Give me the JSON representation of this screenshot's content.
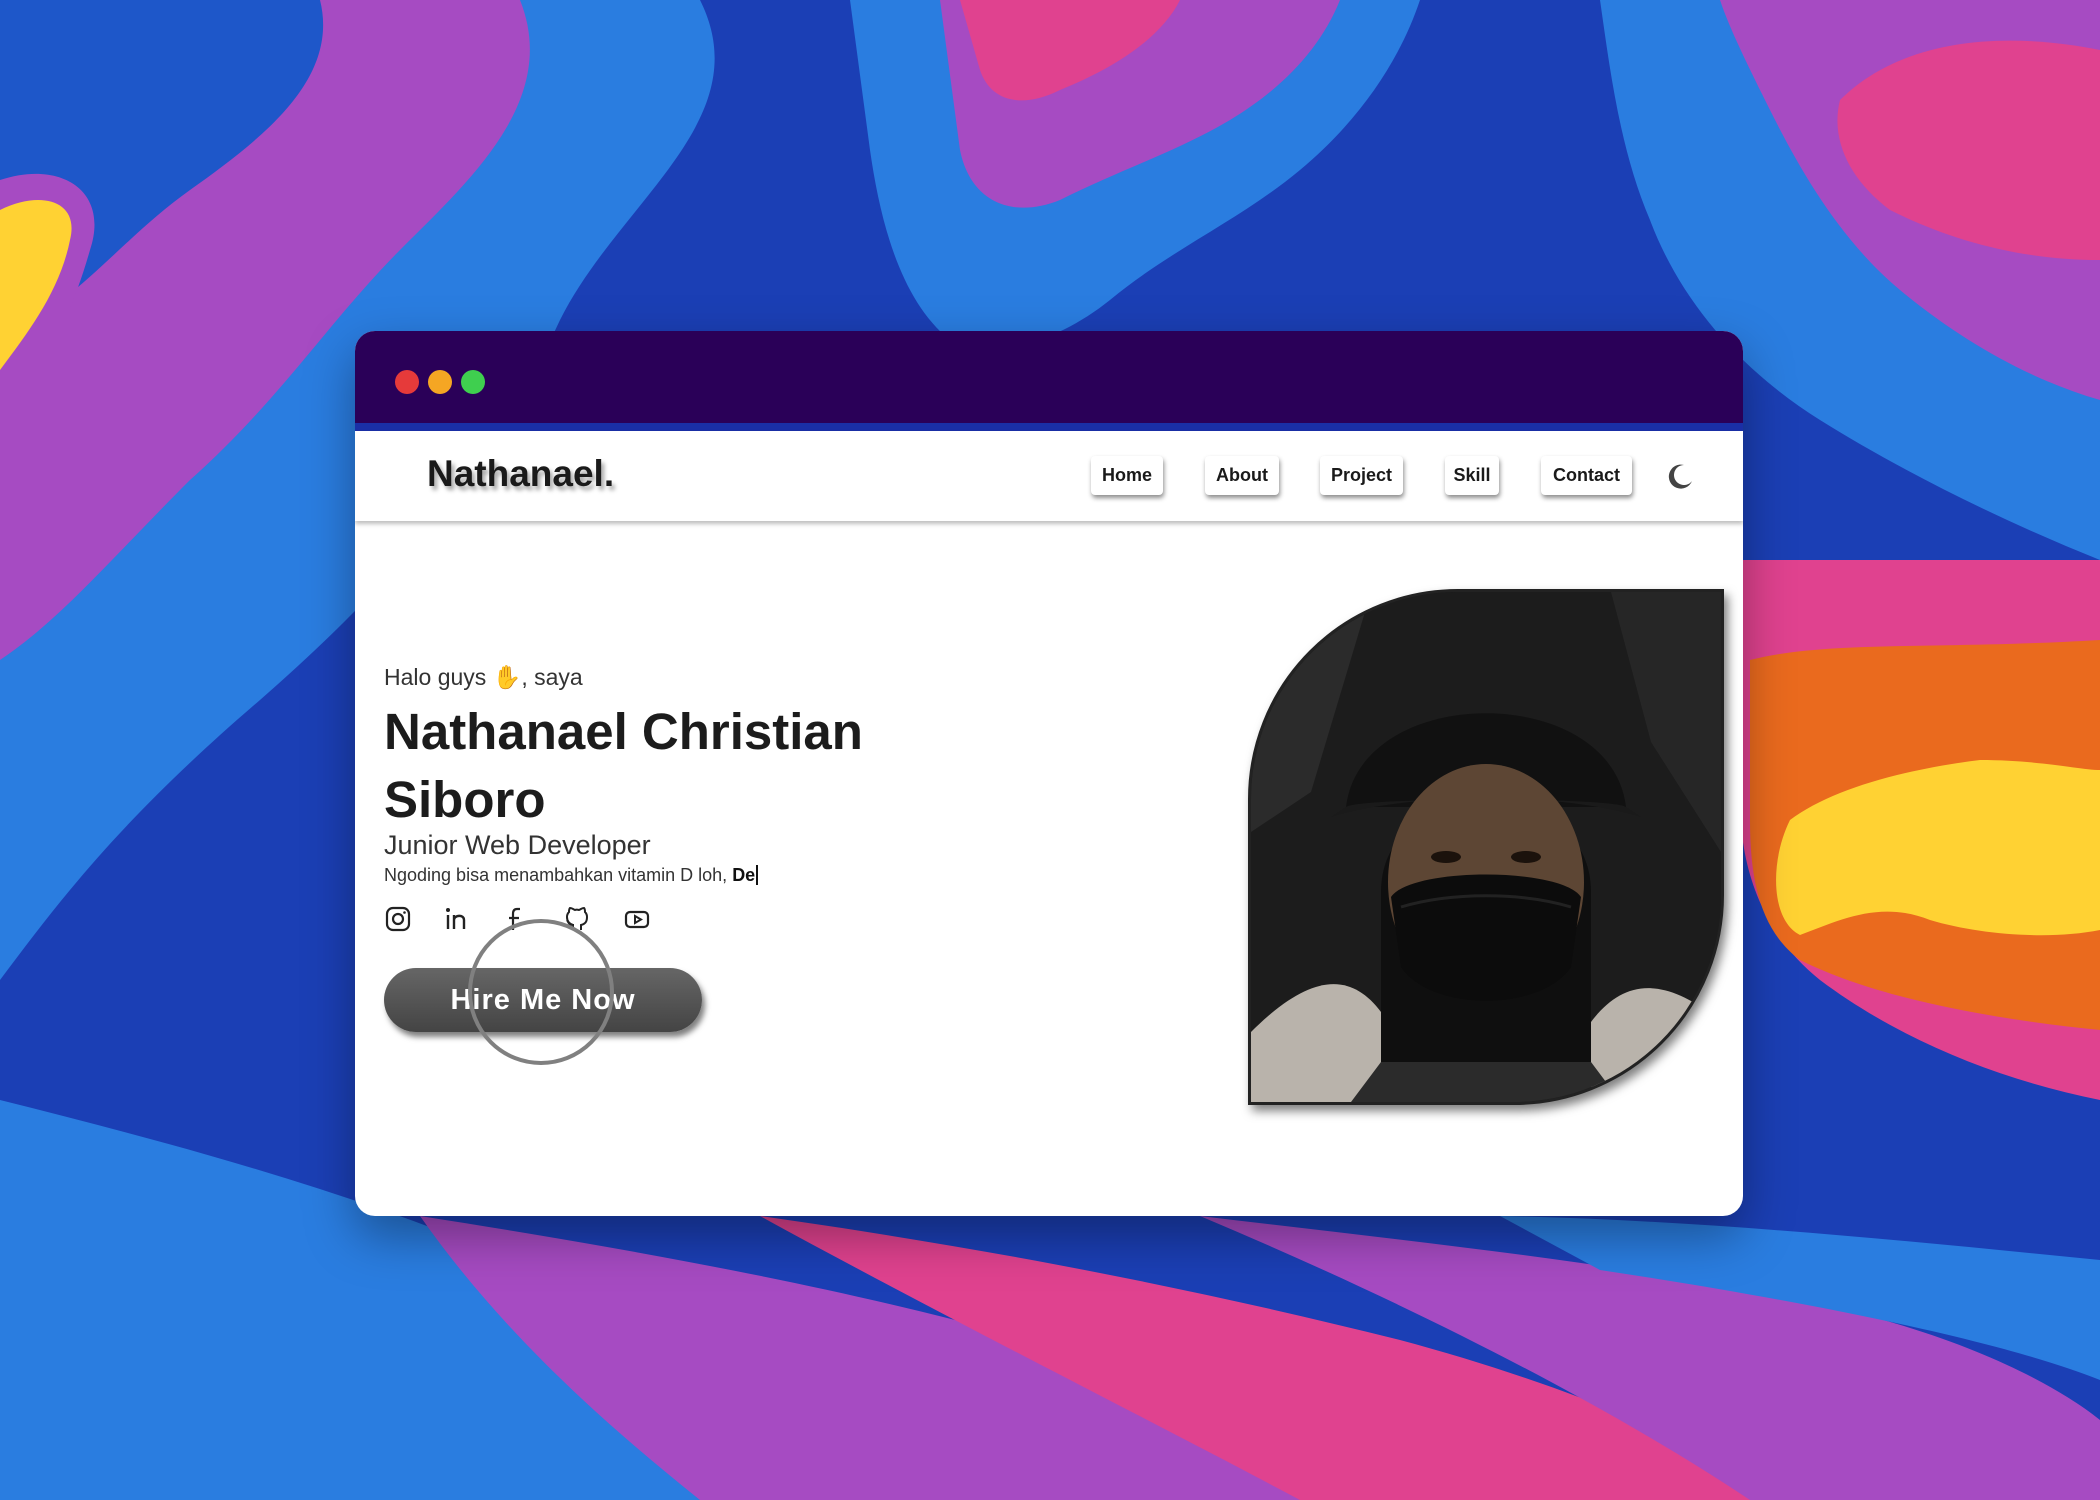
{
  "colors": {
    "titlebar": "#2a0058",
    "window_bg": "#ffffff",
    "button_bg": "#555555",
    "bg_blue_dark": "#1b3fb5",
    "bg_blue_light": "#2a7de0",
    "bg_purple": "#a64bc2",
    "bg_pink": "#e0428f",
    "bg_orange": "#ea6a1e",
    "bg_yellow": "#ffd233"
  },
  "window": {
    "controls": [
      "close",
      "minimize",
      "maximize"
    ]
  },
  "navbar": {
    "brand": "Nathanael.",
    "items": [
      {
        "label": "Home"
      },
      {
        "label": "About"
      },
      {
        "label": "Project"
      },
      {
        "label": "Skill"
      },
      {
        "label": "Contact"
      }
    ],
    "theme_toggle_icon": "moon-icon"
  },
  "hero": {
    "greeting_prefix": "Halo guys ",
    "greeting_emoji": "✋",
    "greeting_suffix": ", saya",
    "name": "Nathanael Christian Siboro",
    "role": "Junior Web Developer",
    "tagline": "Ngoding bisa menambahkan vitamin D loh, ",
    "tagline_typed": "De",
    "social_icons": [
      "instagram-icon",
      "linkedin-icon",
      "facebook-icon",
      "github-icon",
      "youtube-icon"
    ],
    "cta": "Hire Me Now"
  }
}
